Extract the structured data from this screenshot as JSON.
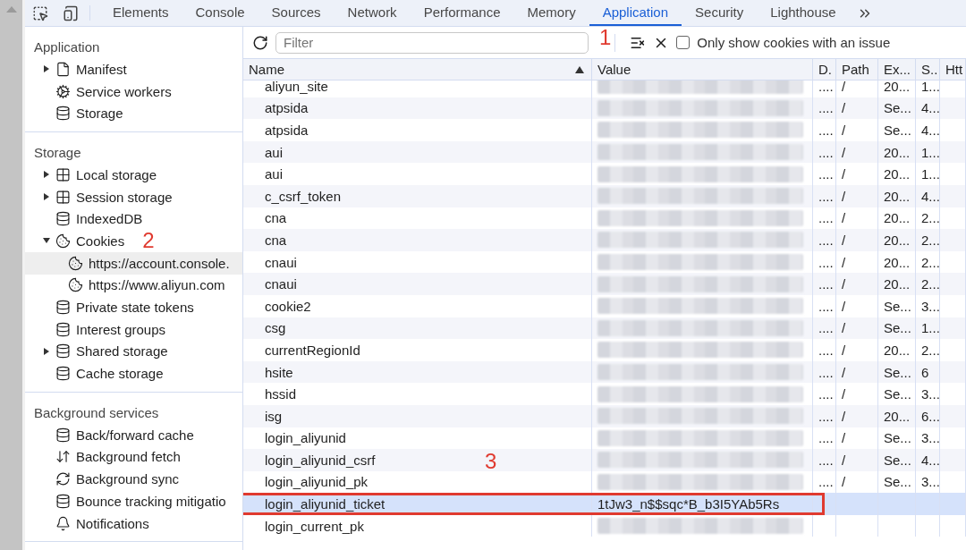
{
  "tabs": [
    {
      "label": "Elements",
      "selected": false
    },
    {
      "label": "Console",
      "selected": false
    },
    {
      "label": "Sources",
      "selected": false
    },
    {
      "label": "Network",
      "selected": false
    },
    {
      "label": "Performance",
      "selected": false
    },
    {
      "label": "Memory",
      "selected": false
    },
    {
      "label": "Application",
      "selected": true,
      "annotation": "1"
    },
    {
      "label": "Security",
      "selected": false
    },
    {
      "label": "Lighthouse",
      "selected": false
    }
  ],
  "sidebar": {
    "sections": [
      {
        "title": "Application",
        "items": [
          {
            "label": "Manifest",
            "kind": "file",
            "expanded": false,
            "selected": false
          },
          {
            "label": "Service workers",
            "kind": "gears",
            "selected": false
          },
          {
            "label": "Storage",
            "kind": "database",
            "selected": false
          }
        ]
      },
      {
        "title": "Storage",
        "items": [
          {
            "label": "Local storage",
            "kind": "table",
            "expanded": false,
            "selected": false
          },
          {
            "label": "Session storage",
            "kind": "table",
            "expanded": false,
            "selected": false
          },
          {
            "label": "IndexedDB",
            "kind": "database",
            "selected": false
          },
          {
            "label": "Cookies",
            "kind": "cookie",
            "expanded": true,
            "selected": false,
            "annotation": "2",
            "children": [
              {
                "label": "https://account.console.",
                "kind": "cookie",
                "selected": true
              },
              {
                "label": "https://www.aliyun.com",
                "kind": "cookie",
                "selected": false
              }
            ]
          },
          {
            "label": "Private state tokens",
            "kind": "database",
            "selected": false
          },
          {
            "label": "Interest groups",
            "kind": "database",
            "selected": false
          },
          {
            "label": "Shared storage",
            "kind": "database",
            "expanded": false,
            "selected": false
          },
          {
            "label": "Cache storage",
            "kind": "database",
            "selected": false
          }
        ]
      },
      {
        "title": "Background services",
        "items": [
          {
            "label": "Back/forward cache",
            "kind": "database",
            "selected": false
          },
          {
            "label": "Background fetch",
            "kind": "updown",
            "selected": false
          },
          {
            "label": "Background sync",
            "kind": "sync",
            "selected": false
          },
          {
            "label": "Bounce tracking mitigatio",
            "kind": "database",
            "selected": false
          },
          {
            "label": "Notifications",
            "kind": "bell",
            "selected": false
          }
        ]
      }
    ]
  },
  "filter": {
    "placeholder": "Filter",
    "only_issues": {
      "label": "Only show cookies with an issue",
      "checked": false
    }
  },
  "table": {
    "columns": [
      {
        "label": "Name",
        "sorted": true
      },
      {
        "label": "Value"
      },
      {
        "label": "D."
      },
      {
        "label": "Path"
      },
      {
        "label": "Ex..."
      },
      {
        "label": "S.."
      },
      {
        "label": "Htt"
      }
    ],
    "rows": [
      {
        "name": "aliyun_site",
        "redacted": true,
        "column_3": "....",
        "path": "/",
        "column_5": "20...",
        "column_6": "1...",
        "selected": false
      },
      {
        "name": "atpsida",
        "redacted": true,
        "column_3": "....",
        "path": "/",
        "column_5": "Se...",
        "column_6": "4...",
        "selected": false
      },
      {
        "name": "atpsida",
        "redacted": true,
        "column_3": "....",
        "path": "/",
        "column_5": "Se...",
        "column_6": "4...",
        "selected": false
      },
      {
        "name": "aui",
        "redacted": true,
        "column_3": "....",
        "path": "/",
        "column_5": "20...",
        "column_6": "1...",
        "selected": false
      },
      {
        "name": "aui",
        "redacted": true,
        "column_3": "....",
        "path": "/",
        "column_5": "20...",
        "column_6": "1...",
        "selected": false
      },
      {
        "name": "c_csrf_token",
        "redacted": true,
        "column_3": "....",
        "path": "/",
        "column_5": "20...",
        "column_6": "4...",
        "selected": false
      },
      {
        "name": "cna",
        "redacted": true,
        "column_3": "....",
        "path": "/",
        "column_5": "20...",
        "column_6": "2...",
        "selected": false
      },
      {
        "name": "cna",
        "redacted": true,
        "column_3": "....",
        "path": "/",
        "column_5": "20...",
        "column_6": "2...",
        "selected": false
      },
      {
        "name": "cnaui",
        "redacted": true,
        "column_3": "....",
        "path": "/",
        "column_5": "20...",
        "column_6": "2...",
        "selected": false
      },
      {
        "name": "cnaui",
        "redacted": true,
        "column_3": "....",
        "path": "/",
        "column_5": "20...",
        "column_6": "2...",
        "selected": false
      },
      {
        "name": "cookie2",
        "redacted": true,
        "column_3": "....",
        "path": "/",
        "column_5": "Se...",
        "column_6": "3...",
        "selected": false
      },
      {
        "name": "csg",
        "redacted": true,
        "column_3": "....",
        "path": "/",
        "column_5": "Se...",
        "column_6": "1...",
        "selected": false
      },
      {
        "name": "currentRegionId",
        "redacted": true,
        "column_3": "....",
        "path": "/",
        "column_5": "20...",
        "column_6": "2...",
        "selected": false
      },
      {
        "name": "hsite",
        "redacted": true,
        "column_3": "....",
        "path": "/",
        "column_5": "Se...",
        "column_6": "6",
        "selected": false
      },
      {
        "name": "hssid",
        "redacted": true,
        "column_3": "....",
        "path": "/",
        "column_5": "Se...",
        "column_6": "3...",
        "selected": false
      },
      {
        "name": "isg",
        "redacted": true,
        "column_3": "....",
        "path": "/",
        "column_5": "20...",
        "column_6": "6...",
        "selected": false
      },
      {
        "name": "login_aliyunid",
        "redacted": true,
        "column_3": "....",
        "path": "/",
        "column_5": "Se...",
        "column_6": "3...",
        "selected": false
      },
      {
        "name": "login_aliyunid_csrf",
        "redacted": true,
        "column_3": "....",
        "path": "/",
        "column_5": "Se...",
        "column_6": "4...",
        "selected": false,
        "annotation": "3"
      },
      {
        "name": "login_aliyunid_pk",
        "redacted": true,
        "column_3": "....",
        "path": "/",
        "column_5": "Se...",
        "column_6": "3...",
        "selected": false
      },
      {
        "name": "login_aliyunid_ticket",
        "value": "1tJw3_n$$sqc*B_b3I5YAb5Rs",
        "redacted": false,
        "selected": true,
        "highlighted": true
      },
      {
        "name": "login_current_pk",
        "redacted": true,
        "selected": false
      }
    ]
  }
}
